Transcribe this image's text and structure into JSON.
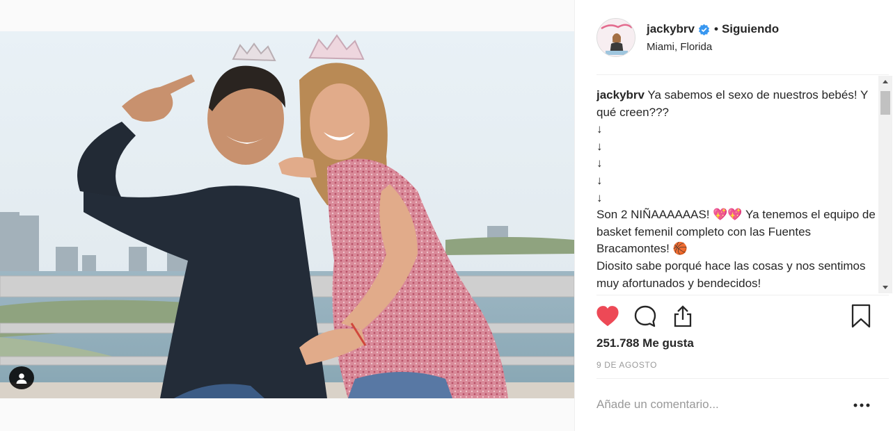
{
  "post": {
    "username": "jackybrv",
    "separator": "•",
    "follow_status": "Siguiendo",
    "location": "Miami, Florida",
    "caption_lines": [
      "Ya sabemos el sexo de nuestros bebés! Y qué creen???",
      "↓",
      "↓",
      "↓",
      "↓",
      "↓",
      "Son 2 NIÑAAAAAAS! 💖💖 Ya tenemos el equipo de basket femenil completo con las Fuentes Bracamontes! 🏀",
      "Diosito sabe porqué hace las cosas y nos sentimos muy afortunados y bendecidos!"
    ],
    "likes": "251.788 Me gusta",
    "date": "9 DE AGOSTO",
    "comment_placeholder": "Añade un comentario...",
    "liked": true
  },
  "colors": {
    "like_red": "#ed4956",
    "verified_blue": "#3897f0",
    "text": "#262626",
    "muted": "#999999"
  },
  "icons": {
    "like": "heart-icon",
    "comment": "comment-icon",
    "share": "share-icon",
    "save": "bookmark-icon",
    "tag": "user-tag-icon",
    "verified": "verified-badge-icon",
    "more": "ellipsis-icon"
  }
}
